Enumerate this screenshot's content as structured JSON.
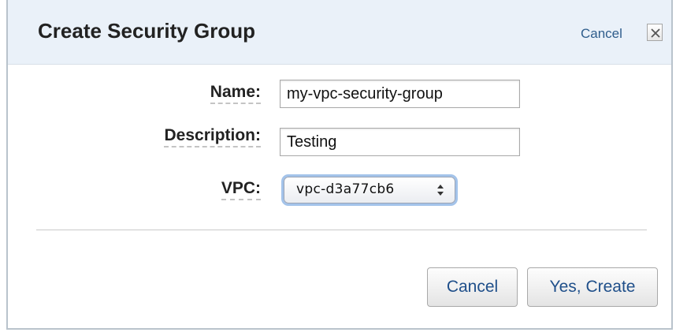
{
  "dialog": {
    "title": "Create Security Group",
    "cancel_link": "Cancel",
    "close_icon": "close-icon"
  },
  "form": {
    "name": {
      "label": "Name:",
      "value": "my-vpc-security-group"
    },
    "description": {
      "label": "Description:",
      "value": "Testing"
    },
    "vpc": {
      "label": "VPC:",
      "selected": "vpc-d3a77cb6",
      "arrow_icon": "updown-arrows-icon"
    }
  },
  "buttons": {
    "cancel": "Cancel",
    "create": "Yes, Create"
  },
  "colors": {
    "header_bg": "#eaf1f9",
    "link": "#2f5d8c",
    "button_text": "#1f4f8a",
    "focus_ring": "#a3c3ea"
  }
}
